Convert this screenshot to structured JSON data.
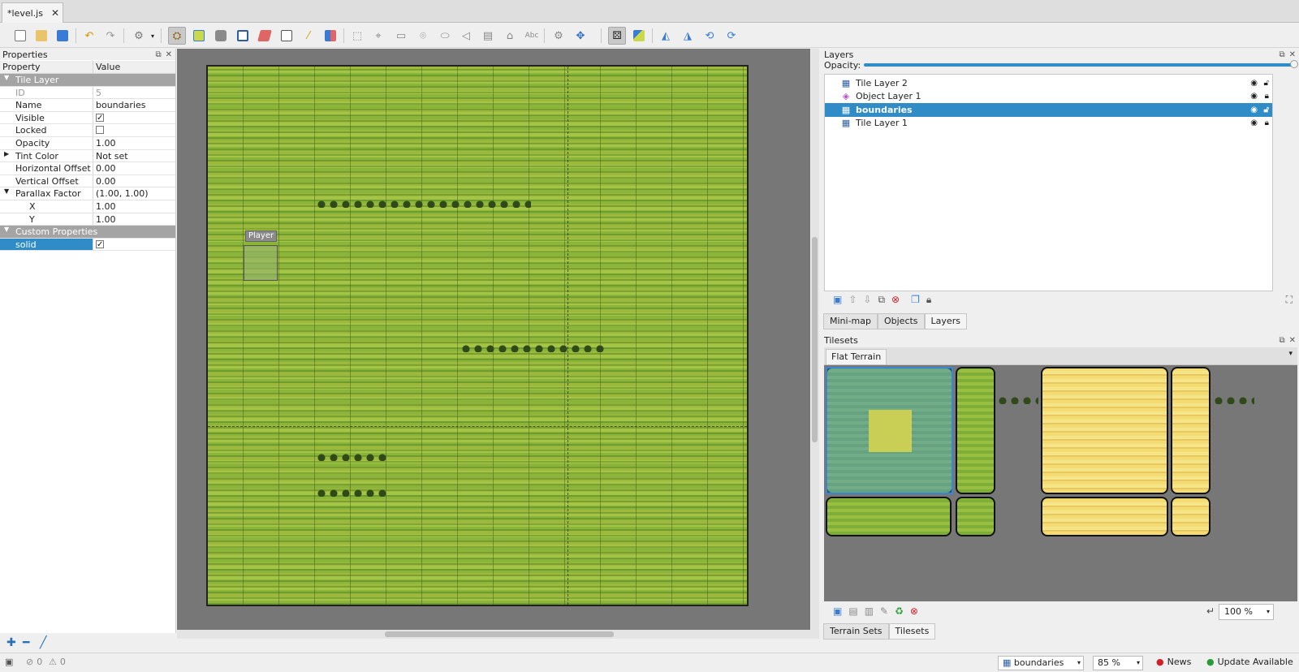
{
  "tab": {
    "title": "*level.js",
    "close": "✕"
  },
  "properties": {
    "title": "Properties",
    "col_property": "Property",
    "col_value": "Value",
    "rows": [
      {
        "key": "Tile Layer",
        "value": ""
      },
      {
        "key": "ID",
        "value": "5"
      },
      {
        "key": "Name",
        "value": "boundaries"
      },
      {
        "key": "Visible",
        "value": ""
      },
      {
        "key": "Locked",
        "value": ""
      },
      {
        "key": "Opacity",
        "value": "1.00"
      },
      {
        "key": "Tint Color",
        "value": "Not set"
      },
      {
        "key": "Horizontal Offset",
        "value": "0.00"
      },
      {
        "key": "Vertical Offset",
        "value": "0.00"
      },
      {
        "key": "Parallax Factor",
        "value": "(1.00, 1.00)"
      },
      {
        "key": "X",
        "value": "1.00"
      },
      {
        "key": "Y",
        "value": "1.00"
      },
      {
        "key": "Custom Properties",
        "value": ""
      },
      {
        "key": "solid",
        "value": ""
      }
    ]
  },
  "canvas": {
    "object_label": "Player"
  },
  "layers": {
    "title": "Layers",
    "opacity_label": "Opacity:",
    "items": [
      {
        "name": "Tile Layer 2",
        "icon": "tile-layer-icon"
      },
      {
        "name": "Object Layer 1",
        "icon": "object-layer-icon"
      },
      {
        "name": "boundaries",
        "icon": "tile-layer-icon"
      },
      {
        "name": "Tile Layer 1",
        "icon": "tile-layer-icon"
      }
    ],
    "tabs": [
      "Mini-map",
      "Objects",
      "Layers"
    ]
  },
  "tilesets": {
    "title": "Tilesets",
    "active_tileset": "Flat Terrain",
    "zoom": "100 %",
    "tabs": [
      "Terrain Sets",
      "Tilesets"
    ]
  },
  "status": {
    "errors": "0",
    "warnings": "0",
    "layer_select": "boundaries",
    "zoom": "85 %",
    "news": "News",
    "update": "Update Available"
  },
  "colors": {
    "accent": "#308cc6",
    "canvas_bg": "#777777",
    "group_row": "#a4a4a4"
  }
}
